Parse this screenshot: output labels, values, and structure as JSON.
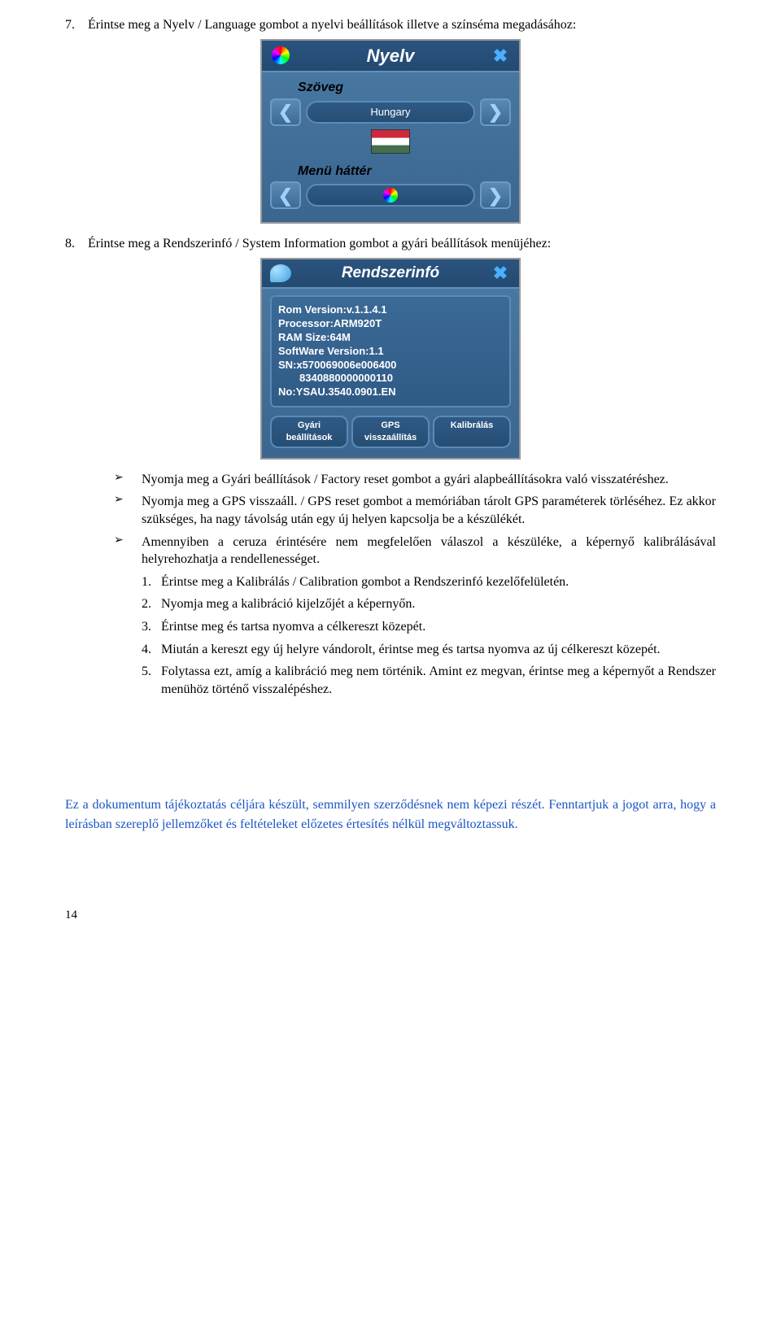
{
  "item7": {
    "num": "7.",
    "text": "Érintse meg a Nyelv / Language gombot a nyelvi beállítások illetve a színséma megadásához:"
  },
  "nyelv_screen": {
    "title": "Nyelv",
    "label_szoveg": "Szöveg",
    "value_szoveg": "Hungary",
    "label_hatter": "Menü háttér"
  },
  "item8": {
    "num": "8.",
    "text": "Érintse meg a Rendszerinfó / System Information gombot a gyári beállítások menüjéhez:"
  },
  "rendszer_screen": {
    "title": "Rendszerinfó",
    "info_lines": {
      "l1": "Rom Version:v.1.1.4.1",
      "l2": "Processor:ARM920T",
      "l3": "RAM Size:64M",
      "l4": "SoftWare Version:1.1",
      "l5": "SN:x570069006e006400",
      "l6": "8340880000000110",
      "l7": "No:YSAU.3540.0901.EN"
    },
    "btn1": "Gyári beállítások",
    "btn2": "GPS visszaállítás",
    "btn3": "Kalibrálás"
  },
  "bullets": {
    "b1": "Nyomja meg a Gyári beállítások / Factory reset gombot a gyári alapbeállításokra való visszatéréshez.",
    "b2": "Nyomja meg a GPS visszaáll. / GPS reset gombot a memóriában tárolt GPS paraméterek törléséhez. Ez akkor szükséges, ha nagy távolság után egy új helyen kapcsolja be a készülékét.",
    "b3": "Amennyiben a ceruza érintésére nem megfelelően válaszol a készüléke, a képernyő kalibrálásával helyrehozhatja a rendellenességet."
  },
  "sublist": {
    "s1n": "1.",
    "s1": "Érintse meg a Kalibrálás / Calibration gombot a Rendszerinfó kezelőfelületén.",
    "s2n": "2.",
    "s2": "Nyomja meg a kalibráció kijelzőjét a képernyőn.",
    "s3n": "3.",
    "s3": "Érintse meg és tartsa nyomva a célkereszt közepét.",
    "s4n": "4.",
    "s4": "Miután a kereszt egy új helyre vándorolt, érintse meg és tartsa nyomva az új célkereszt közepét.",
    "s5n": "5.",
    "s5": "Folytassa ezt, amíg a kalibráció meg nem történik. Amint ez megvan, érintse meg a képernyőt a Rendszer menühöz történő visszalépéshez."
  },
  "disclaimer": "Ez a dokumentum tájékoztatás céljára készült, semmilyen szerződésnek nem képezi részét. Fenntartjuk a jogot arra, hogy a leírásban szereplő jellemzőket és feltételeket előzetes értesítés nélkül megváltoztassuk.",
  "page_num": "14"
}
